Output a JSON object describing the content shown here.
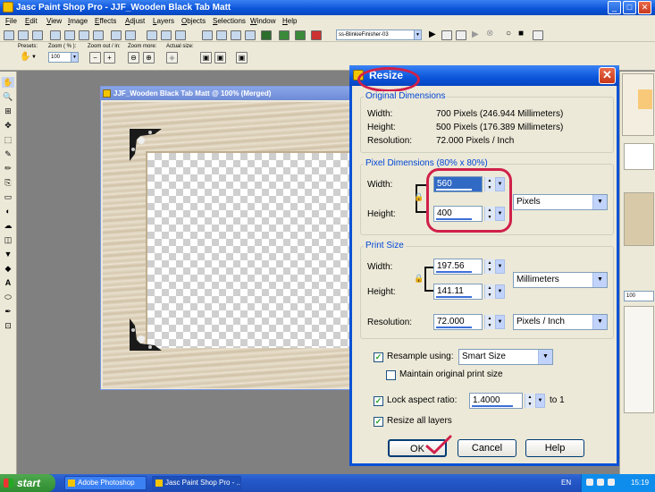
{
  "app": {
    "title": "Jasc Paint Shop Pro - JJF_Wooden Black Tab Matt"
  },
  "menu": [
    "File",
    "Edit",
    "View",
    "Image",
    "Effects",
    "Adjust",
    "Layers",
    "Objects",
    "Selections",
    "Window",
    "Help"
  ],
  "toolbar": {
    "enhance_photo": "Enhance Photo",
    "script_name": "ss-BlinkieFinisher-03",
    "presets_label": "Presets:",
    "zoom_label": "Zoom ( % ):",
    "zoom_value": "100",
    "zoom_out_in_label": "Zoom out / in:",
    "zoom_more_label": "Zoom more:",
    "actual_size_label": "Actual size:"
  },
  "document": {
    "title": "JJF_Wooden Black Tab Matt @ 100% (Merged)"
  },
  "dialog": {
    "title": "Resize",
    "original": {
      "heading": "Original Dimensions",
      "width_label": "Width:",
      "width_value": "700 Pixels (246.944 Millimeters)",
      "height_label": "Height:",
      "height_value": "500 Pixels (176.389 Millimeters)",
      "resolution_label": "Resolution:",
      "resolution_value": "72.000 Pixels / Inch"
    },
    "pixel": {
      "heading": "Pixel Dimensions (80% x 80%)",
      "width_label": "Width:",
      "width_value": "560",
      "height_label": "Height:",
      "height_value": "400",
      "units": "Pixels"
    },
    "print": {
      "heading": "Print Size",
      "width_label": "Width:",
      "width_value": "197.56",
      "height_label": "Height:",
      "height_value": "141.11",
      "units": "Millimeters",
      "resolution_label": "Resolution:",
      "resolution_value": "72.000",
      "resolution_units": "Pixels / Inch"
    },
    "resample_label": "Resample using:",
    "resample_value": "Smart Size",
    "maintain_label": "Maintain original print size",
    "lock_label": "Lock aspect ratio:",
    "lock_value": "1.4000",
    "lock_suffix": "to 1",
    "resize_all_label": "Resize all layers",
    "ok": "OK",
    "cancel": "Cancel",
    "help": "Help"
  },
  "palette": {
    "value_100": "100"
  },
  "taskbar": {
    "start": "start",
    "tasks": [
      "Adobe Photoshop",
      "Jasc Paint Shop Pro - ..."
    ],
    "lang": "EN",
    "clock": "15:19"
  },
  "colors": {
    "annotation": "#d0204a",
    "check": "#21a121",
    "xp_blue": "#0a52d6"
  }
}
